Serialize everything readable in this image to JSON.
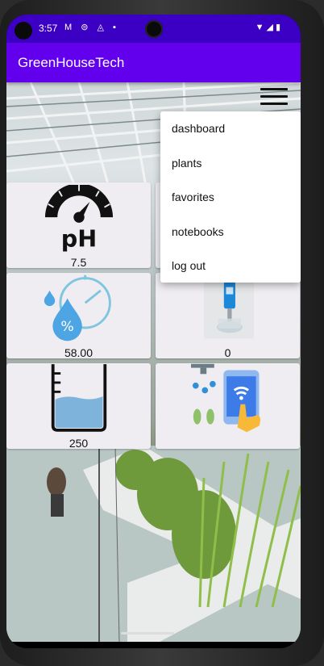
{
  "status_bar": {
    "time": "3:57",
    "left_icons": "M ⊜ ◬ ▪",
    "right_icons": "▼◢▮"
  },
  "app": {
    "title": "GreenHouseTech"
  },
  "tiles": [
    {
      "name": "ph",
      "value": "7.5",
      "icon": "ph-gauge-icon"
    },
    {
      "name": "tds-meter",
      "value": "",
      "icon": "meter-icon"
    },
    {
      "name": "humidity",
      "value": "58.00",
      "icon": "humidity-drop-icon"
    },
    {
      "name": "ec-meter",
      "value": "0",
      "icon": "ec-meter-icon"
    },
    {
      "name": "water-level",
      "value": "250",
      "icon": "beaker-icon"
    },
    {
      "name": "irrigation",
      "value": "",
      "icon": "smart-irrigation-icon"
    }
  ],
  "menu": {
    "items": [
      {
        "label": "dashboard"
      },
      {
        "label": "plants"
      },
      {
        "label": "favorites"
      },
      {
        "label": "notebooks"
      },
      {
        "label": "log out"
      }
    ]
  },
  "colors": {
    "status_bar": "#3c00c4",
    "app_bar": "#6200ee",
    "tile_bg": "#efedf1",
    "menu_bg": "#ffffff"
  }
}
